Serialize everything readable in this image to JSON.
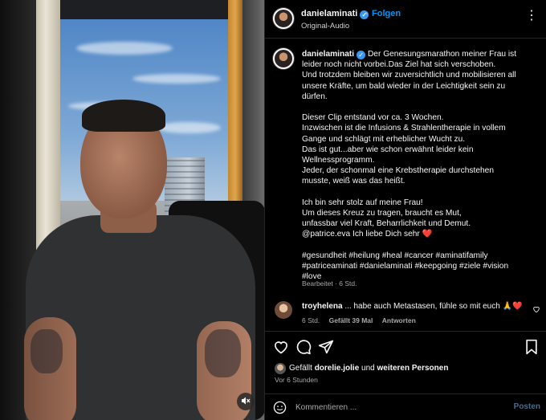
{
  "header": {
    "username": "danielaminati",
    "follow_label": "Folgen",
    "separator": "•",
    "audio_label": "Original-Audio",
    "more_icon": "more-horizontal-icon"
  },
  "caption": {
    "username": "danielaminati",
    "lines": [
      "Der Genesungsmarathon meiner Frau ist",
      "leider noch nicht vorbei.Das Ziel hat sich verschoben.",
      "Und trotzdem bleiben wir zuversichtlich und mobilisieren all",
      "unsere Kräfte, um bald wieder in der Leichtigkeit sein zu",
      "dürfen.",
      "",
      "Dieser Clip entstand vor  ca. 3 Wochen.",
      "Inzwischen ist die Infusions & Strahlentherapie in vollem",
      "Gange und schlägt mit erheblicher Wucht zu.",
      "Das ist gut...aber wie schon erwähnt leider  kein",
      "Wellnessprogramm.",
      "Jeder,  der schonmal eine Krebstherapie durchstehen",
      "musste, weiß was das heißt.",
      "",
      "Ich bin sehr stolz auf meine Frau!",
      "Um dieses Kreuz zu tragen, braucht es Mut,",
      "unfassbar viel Kraft, Beharrlichkeit und Demut.",
      "@patrice.eva Ich liebe Dich sehr",
      "",
      "#gesundheit #heilung #heal #cancer #aminatifamily",
      "#patriceaminati #danielaminati #keepgoing #ziele #vision",
      "#love"
    ],
    "heart_emoji": "❤️",
    "meta": "Bearbeitet · 6 Std."
  },
  "comment": {
    "username": "troyhelena",
    "text": "... habe auch Metastasen, fühle so mit euch 🙏❤️",
    "time": "6 Std.",
    "likes": "Gefällt 39 Mal",
    "reply_label": "Antworten"
  },
  "actions": {
    "like_icon": "heart-icon",
    "comment_icon": "comment-icon",
    "share_icon": "share-icon",
    "save_icon": "bookmark-icon"
  },
  "likes": {
    "prefix": "Gefällt",
    "user": "dorelie.jolie",
    "middle": "und",
    "others": "weiteren Personen",
    "time": "Vor 6 Stunden"
  },
  "composer": {
    "placeholder": "Kommentieren ...",
    "post_label": "Posten"
  },
  "colors": {
    "accent": "#0095f6",
    "verified": "#3897f0",
    "background": "#000000",
    "muted_text": "#a8a8a8",
    "heart": "#ed4956"
  }
}
